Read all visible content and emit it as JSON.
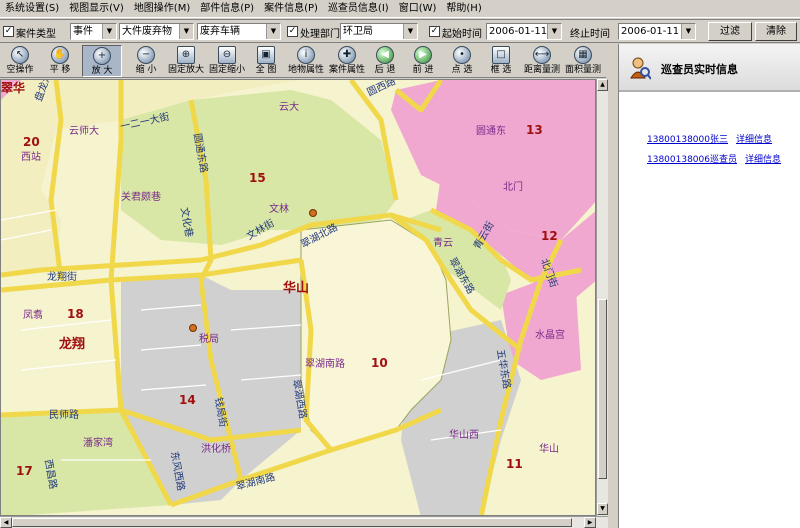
{
  "menu": [
    "系统设置(S)",
    "视图显示(V)",
    "地图操作(M)",
    "部件信息(P)",
    "案件信息(P)",
    "巡查员信息(I)",
    "窗口(W)",
    "帮助(H)"
  ],
  "filter": {
    "case_type_label": "案件类型",
    "case_type_value": "事件",
    "category_value": "大件废弃物",
    "subcategory_value": "废弃车辆",
    "dept_label": "处理部门",
    "dept_value": "环卫局",
    "start_label": "起始时间",
    "start_value": "2006-01-11",
    "end_label": "终止时间",
    "end_value": "2006-01-11",
    "filter_button": "过滤",
    "clear_button": "清除"
  },
  "toolbar": [
    {
      "name": "empty-operation",
      "label": "空操作",
      "icon": "cursor-icon"
    },
    {
      "name": "pan",
      "label": "平 移",
      "icon": "hand-icon"
    },
    {
      "name": "zoom-in",
      "label": "放 大",
      "icon": "zoom-in-icon"
    },
    {
      "name": "zoom-out",
      "label": "缩 小",
      "icon": "zoom-out-icon"
    },
    {
      "name": "fixed-zoom-in",
      "label": "固定放大",
      "icon": "fixed-zoom-in-icon"
    },
    {
      "name": "fixed-zoom-out",
      "label": "固定缩小",
      "icon": "fixed-zoom-out-icon"
    },
    {
      "name": "full-map",
      "label": "全 图",
      "icon": "full-extent-icon"
    },
    {
      "name": "feature-attr",
      "label": "地物属性",
      "icon": "info-icon"
    },
    {
      "name": "case-attr",
      "label": "案件属性",
      "icon": "case-icon"
    },
    {
      "name": "back",
      "label": "后 退",
      "icon": "arrow-left-icon"
    },
    {
      "name": "forward",
      "label": "前 进",
      "icon": "arrow-right-icon"
    },
    {
      "name": "point-select",
      "label": "点 选",
      "icon": "point-select-icon"
    },
    {
      "name": "box-select",
      "label": "框 选",
      "icon": "box-select-icon"
    },
    {
      "name": "measure-distance",
      "label": "距离量测",
      "icon": "ruler-icon"
    },
    {
      "name": "measure-area",
      "label": "面积量测",
      "icon": "area-icon"
    }
  ],
  "panel": {
    "title": "巡查员实时信息",
    "inspectors": [
      {
        "text": "13800138000张三",
        "detail": "详细信息"
      },
      {
        "text": "13800138006巡查员",
        "detail": "详细信息"
      }
    ]
  },
  "map": {
    "district_numbers": [
      "20",
      "13",
      "15",
      "12",
      "18",
      "10",
      "14",
      "17",
      "11"
    ],
    "labels": {
      "a": "翠华",
      "b": "西站",
      "c": "云师大",
      "d": "一二一大街",
      "e": "云大",
      "f": "圆西路",
      "g": "圆通东",
      "h": "北门",
      "i": "关君颇巷",
      "j": "文林",
      "k": "文化巷",
      "l": "文林街",
      "m": "翠湖北路",
      "n": "青云",
      "o": "翠湖东路",
      "p": "青云街",
      "q": "北门街",
      "r": "龙翔街",
      "s": "华山",
      "t": "凤翥",
      "u": "龙翔",
      "v": "税局",
      "w": "翠湖南路",
      "x": "水晶宫",
      "y": "翠湖西路",
      "z": "钱局街",
      "aa": "洪化桥",
      "ab": "民师路",
      "ac": "潘家湾",
      "ad": "东风西路",
      "ae": "翠湖南路",
      "af": "华山西",
      "ag": "华山",
      "ah": "西昌路",
      "ai": "五华东路",
      "aj": "圆通东路",
      "ak": "盘龙江路"
    }
  }
}
